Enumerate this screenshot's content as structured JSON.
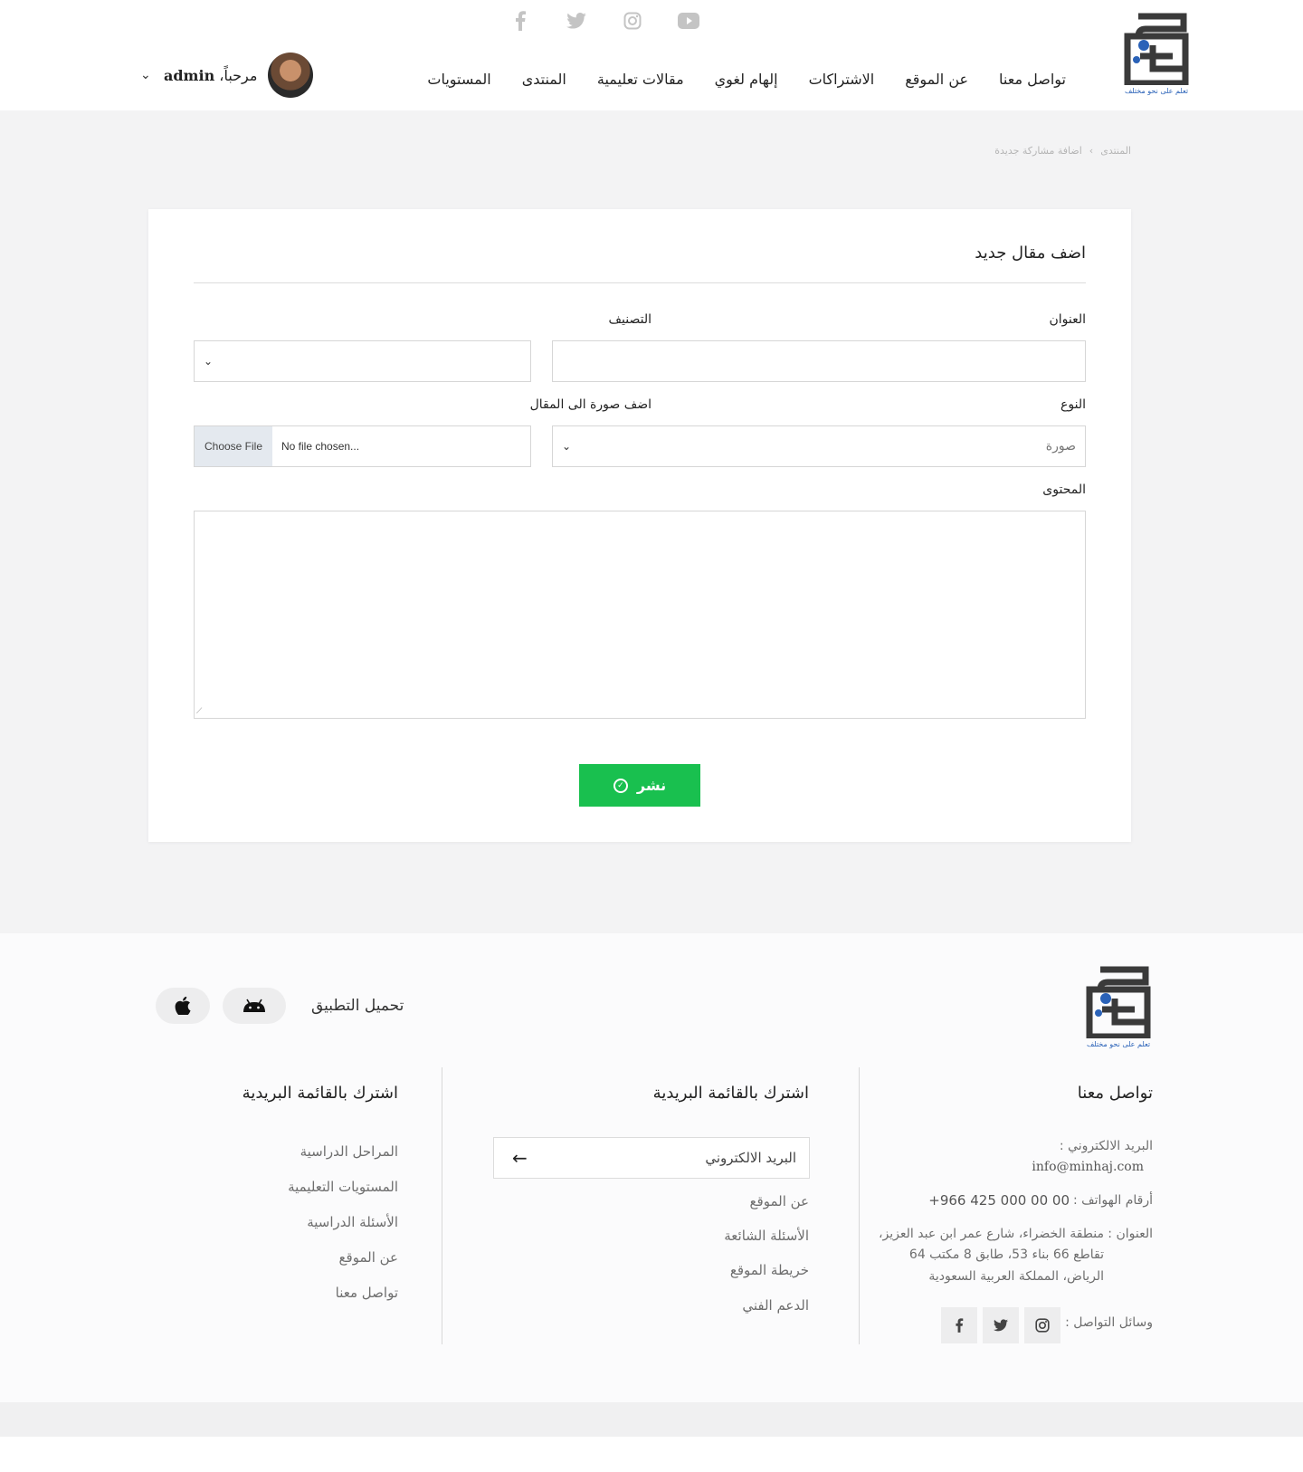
{
  "header": {
    "logo_tagline": "تعلم على نحو مختلف",
    "social_icons": [
      "facebook-icon",
      "twitter-icon",
      "instagram-icon",
      "youtube-icon"
    ],
    "nav": [
      "المستويات",
      "المنتدى",
      "مقالات تعليمية",
      "إلهام لغوي",
      "الاشتراكات",
      "عن الموقع",
      "تواصل معنا"
    ],
    "user": {
      "greeting": "مرحباً،",
      "name": "admin"
    }
  },
  "breadcrumb": [
    "المنتدى",
    "اضافة مشاركة جديدة"
  ],
  "form": {
    "title": "اضف مقال جديد",
    "title_label": "العنوان",
    "category_label": "التصنيف",
    "type_label": "النوع",
    "type_value": "صورة",
    "image_label": "اضف صورة الى المقال",
    "choose_file": "Choose File",
    "no_file": "No file chosen...",
    "content_label": "المحتوى",
    "publish": "نشر"
  },
  "footer": {
    "logo_tagline": "تعلم على نحو مختلف",
    "app_label": "تحميل التطبيق",
    "contact": {
      "heading": "تواصل معنا",
      "email_label": "البريد الالكتروني :",
      "email": "info@minhaj.com",
      "phones_label": "أرقام الهواتف :",
      "phones": "+966 425 000 00 00",
      "address_label": "العنوان :",
      "address_lines": [
        "منطقة الخضراء، شارع عمر ابن عبد العزيز،",
        "تقاطع 66 بناء 53، طابق 8 مكتب 64",
        "الرياض، المملكة العربية السعودية"
      ],
      "social_label": "وسائل التواصل :"
    },
    "newsletter": {
      "heading": "اشترك بالقائمة البريدية",
      "email_placeholder": "البريد الالكتروني",
      "links": [
        "عن الموقع",
        "الأسئلة الشائعة",
        "خريطة الموقع",
        "الدعم الفني"
      ]
    },
    "third": {
      "heading": "اشترك بالقائمة البريدية",
      "links": [
        "المراحل الدراسية",
        "المستويات التعليمية",
        "الأسئلة الدراسية",
        "عن الموقع",
        "تواصل معنا"
      ]
    }
  },
  "colors": {
    "accent_green": "#19c04f",
    "logo_dark": "#3a3a3a",
    "logo_blue": "#2a62b8"
  }
}
